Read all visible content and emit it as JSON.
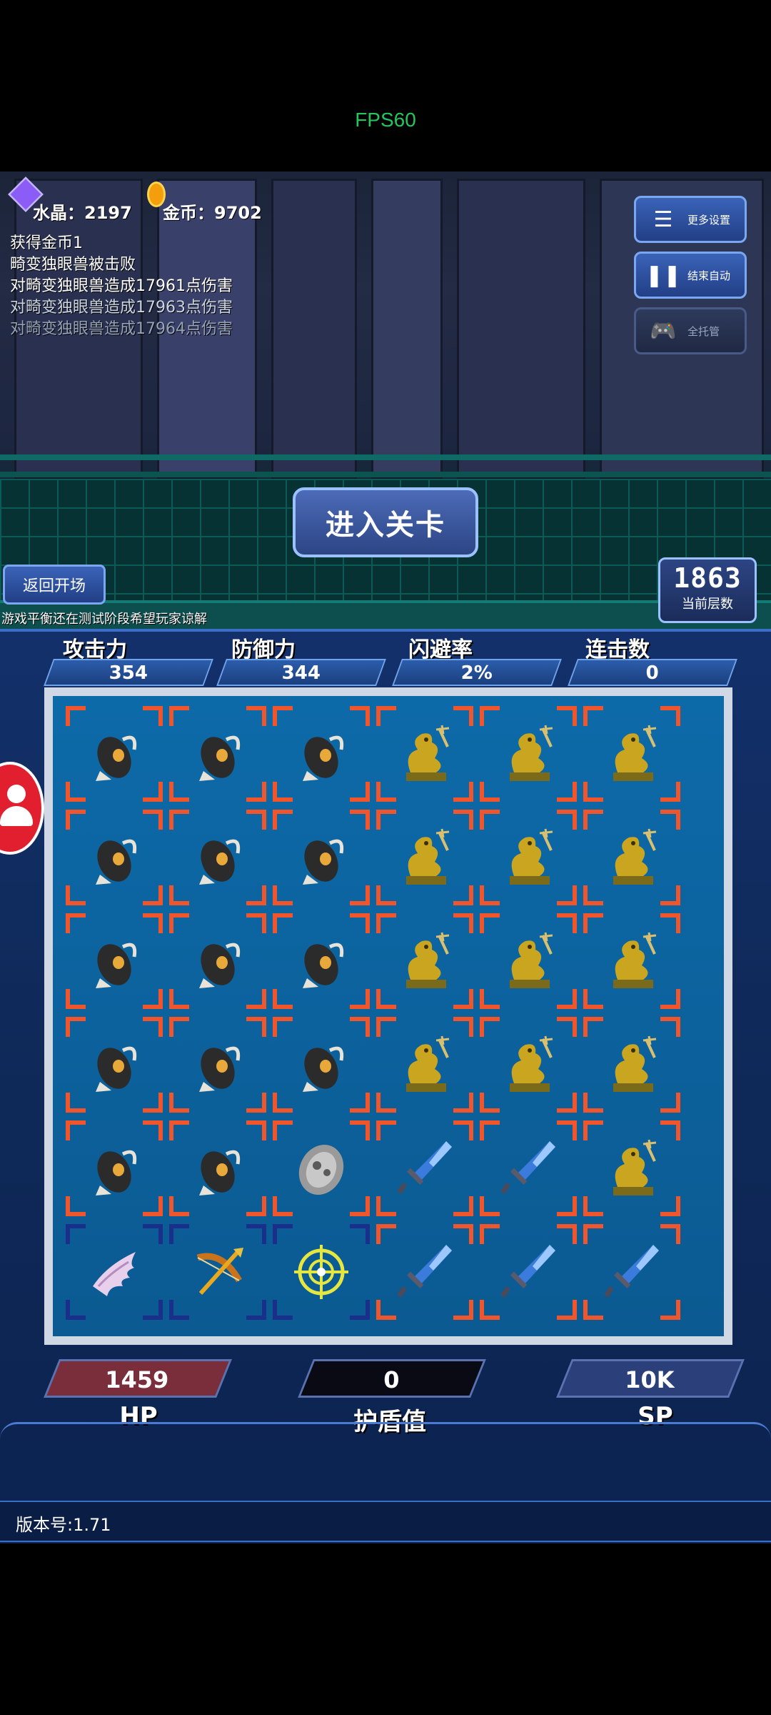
{
  "fps": "FPS60",
  "resources": {
    "crystal": "水晶：2197",
    "gold": "金币：9702"
  },
  "log": [
    "获得金币1",
    "畸变独眼兽被击败",
    "对畸变独眼兽造成17961点伤害",
    "对畸变独眼兽造成17963点伤害",
    "对畸变独眼兽造成17964点伤害"
  ],
  "menu": {
    "settings": "更多设置",
    "stop_auto": "结束自动",
    "full_auto": "全托管"
  },
  "enter_level": "进入关卡",
  "back_to_start": "返回开场",
  "floor": {
    "value": "1863",
    "label": "当前层数"
  },
  "notice": "游戏平衡还在测试阶段希望玩家谅解",
  "stats": [
    {
      "label": "攻击力",
      "value": "354"
    },
    {
      "label": "防御力",
      "value": "344"
    },
    {
      "label": "闪避率",
      "value": "2%"
    },
    {
      "label": "连击数",
      "value": "0"
    }
  ],
  "board": {
    "rows": [
      [
        "grenade",
        "grenade",
        "grenade",
        "dragon",
        "dragon",
        "dragon"
      ],
      [
        "grenade",
        "grenade",
        "grenade",
        "dragon",
        "dragon",
        "dragon"
      ],
      [
        "grenade",
        "grenade",
        "grenade",
        "dragon",
        "dragon",
        "dragon"
      ],
      [
        "grenade",
        "grenade",
        "grenade",
        "dragon",
        "dragon",
        "dragon"
      ],
      [
        "grenade",
        "grenade",
        "shield",
        "sword",
        "sword",
        "dragon"
      ],
      [
        "wing",
        "bow",
        "target",
        "sword",
        "sword",
        "sword"
      ]
    ],
    "frame_colors": {
      "orange": "#f0552b",
      "navy": "#1a2f8a"
    },
    "blue_framed_cells": [
      [
        5,
        0
      ],
      [
        5,
        1
      ],
      [
        5,
        2
      ]
    ]
  },
  "bars": {
    "hp": {
      "value": "1459",
      "label": "HP",
      "color": "#7a2e3c"
    },
    "shield": {
      "value": "0",
      "label": "护盾值",
      "color": "#0a0a14"
    },
    "sp": {
      "value": "10K",
      "label": "SP",
      "color": "#2b3f7a"
    }
  },
  "version": "版本号:1.71"
}
